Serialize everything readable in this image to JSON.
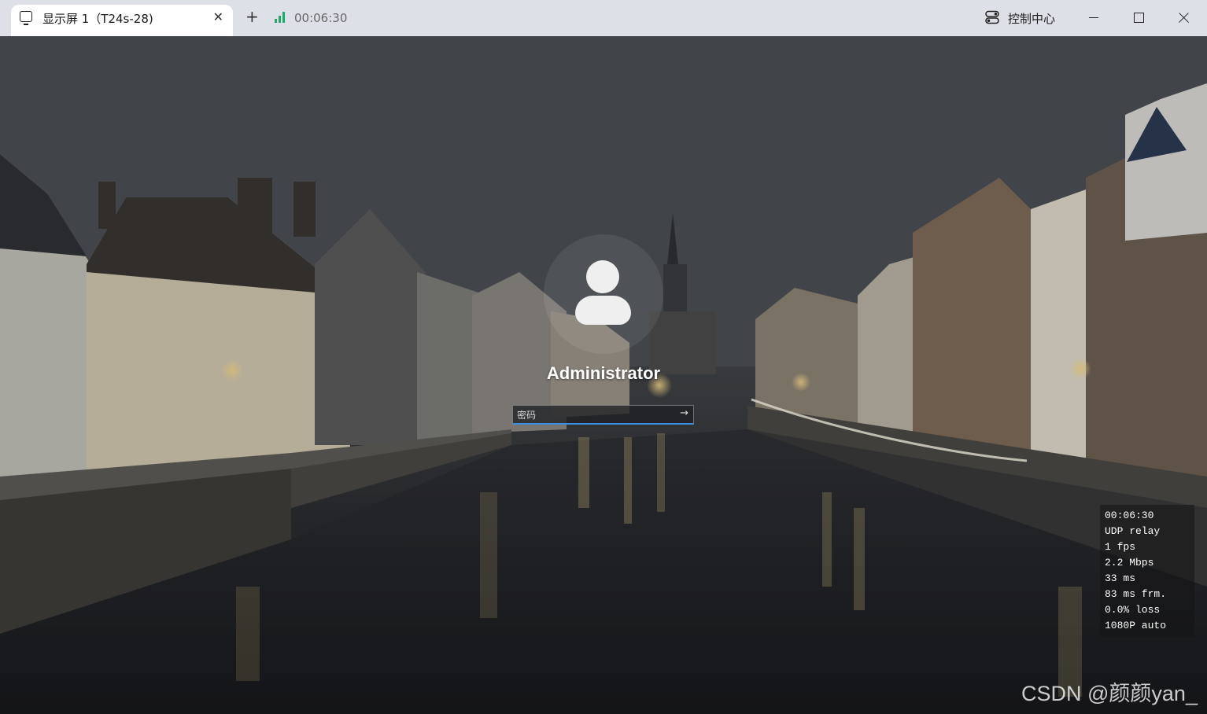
{
  "tab": {
    "label": "显示屏 1（T24s-28)",
    "close_glyph": "✕"
  },
  "new_tab_glyph": "+",
  "connection_timer": "00:06:30",
  "control_center_label": "控制中心",
  "login": {
    "username": "Administrator",
    "password_placeholder": "密码",
    "submit_glyph": "→"
  },
  "stats": [
    "00:06:30",
    "UDP relay",
    "1 fps",
    "2.2 Mbps",
    "33 ms",
    "83 ms frm.",
    "0.0% loss",
    "1080P auto"
  ],
  "watermark": "CSDN @颜颜yan_",
  "colors": {
    "titlebar": "#dde1e7",
    "signal": "#22a86b",
    "input_focus": "#3c8dde"
  },
  "icons": {
    "tab_icon": "monitor-icon",
    "signal_icon": "signal-bars-icon",
    "control_center_icon": "toggle-switches-icon",
    "avatar": "user-silhouette-icon"
  }
}
